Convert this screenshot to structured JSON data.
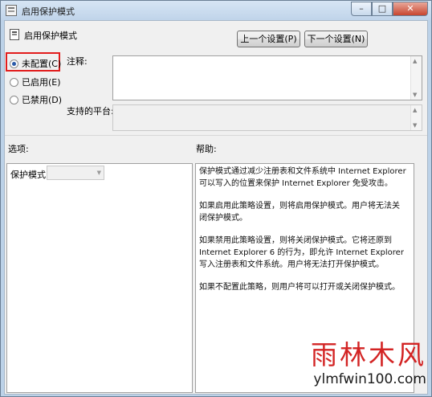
{
  "window": {
    "title": "启用保护模式",
    "min_label": "–",
    "max_label": "□",
    "close_label": "✕"
  },
  "policy": {
    "title": "启用保护模式",
    "prev_button": "上一个设置(P)",
    "next_button": "下一个设置(N)"
  },
  "state": {
    "options": [
      {
        "label": "未配置(C)",
        "checked": true
      },
      {
        "label": "已启用(E)",
        "checked": false
      },
      {
        "label": "已禁用(D)",
        "checked": false
      }
    ]
  },
  "comment": {
    "label": "注释:",
    "value": ""
  },
  "platform": {
    "label": "支持的平台:",
    "value": ""
  },
  "options_section": {
    "header": "选项:",
    "protected_mode_label": "保护模式",
    "protected_mode_value": ""
  },
  "help_section": {
    "header": "帮助:",
    "paragraphs": [
      "保护模式通过减少注册表和文件系统中 Internet Explorer 可以写入的位置来保护 Internet Explorer 免受攻击。",
      "如果启用此策略设置，则将启用保护模式。用户将无法关闭保护模式。",
      "如果禁用此策略设置，则将关闭保护模式。它将还原到 Internet Explorer 6 的行为，即允许 Internet Explorer 写入注册表和文件系统。用户将无法打开保护模式。",
      "如果不配置此策略，则用户将可以打开或关闭保护模式。"
    ]
  },
  "watermark": {
    "chinese": "雨林木风",
    "url": "ylmfwin100.com"
  },
  "colors": {
    "highlight_box": "#e21c1c",
    "watermark_red": "#d32424"
  }
}
